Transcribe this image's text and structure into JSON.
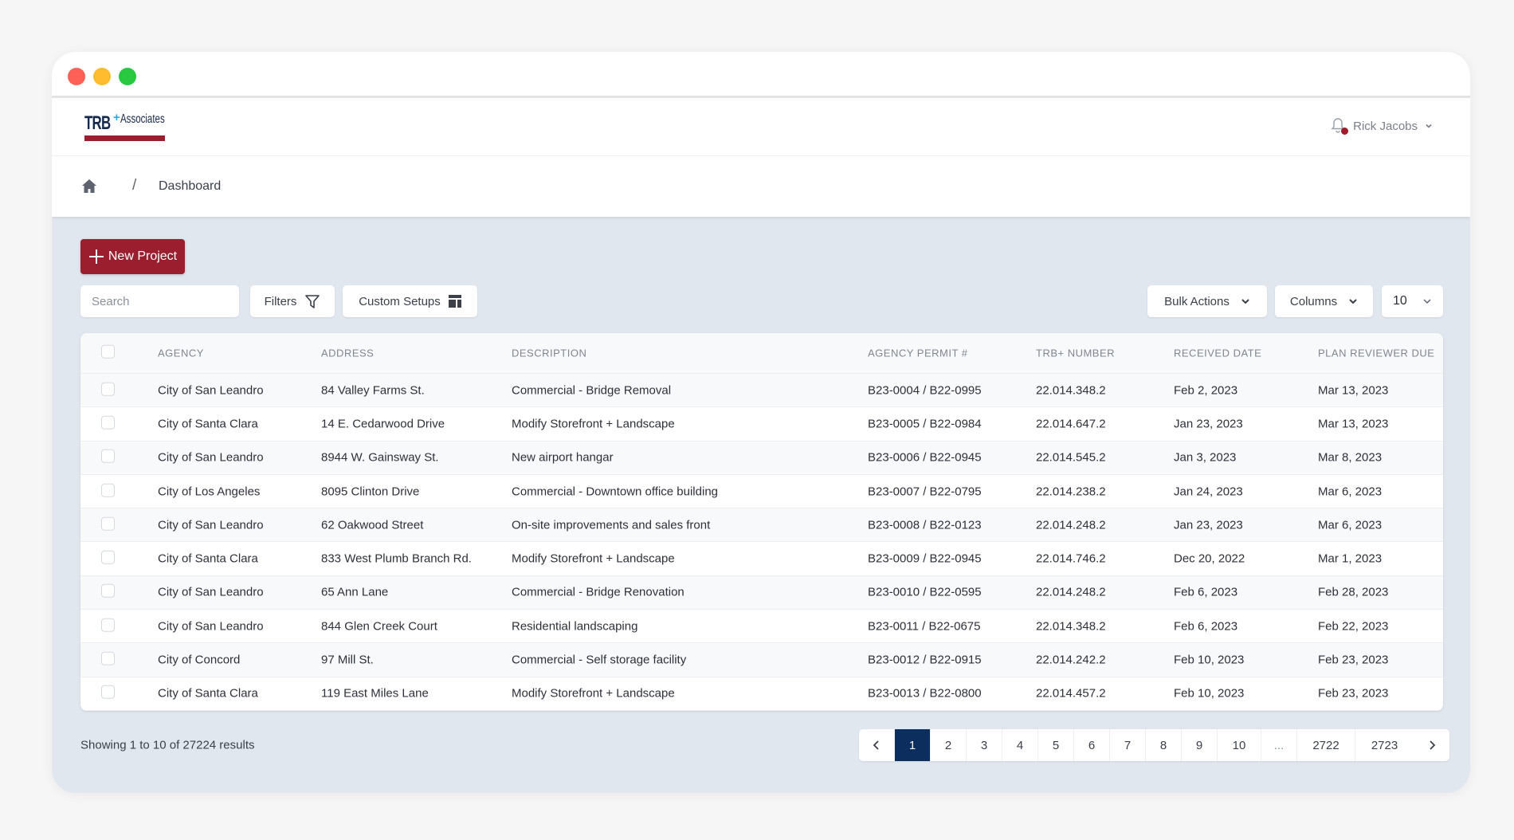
{
  "logo": {
    "text": "TRB",
    "plus": "+",
    "sub": "Associates"
  },
  "user": {
    "name": "Rick Jacobs"
  },
  "breadcrumb": {
    "separator": "/",
    "current": "Dashboard"
  },
  "toolbar": {
    "new_project": "New Project",
    "search_placeholder": "Search",
    "filters": "Filters",
    "custom_setups": "Custom Setups",
    "bulk_actions": "Bulk Actions",
    "columns": "Columns",
    "page_size": "10"
  },
  "table": {
    "headers": [
      "Agency",
      "Address",
      "Description",
      "Agency Permit #",
      "TRB+ Number",
      "Received Date",
      "Plan Reviewer Due"
    ],
    "rows": [
      [
        "City of San Leandro",
        "84 Valley Farms St.",
        "Commercial - Bridge Removal",
        "B23-0004 / B22-0995",
        "22.014.348.2",
        "Feb 2, 2023",
        "Mar 13, 2023"
      ],
      [
        "City of Santa Clara",
        "14 E. Cedarwood Drive",
        "Modify Storefront + Landscape",
        "B23-0005 / B22-0984",
        "22.014.647.2",
        "Jan 23, 2023",
        "Mar 13, 2023"
      ],
      [
        "City of San Leandro",
        "8944 W. Gainsway St.",
        "New airport hangar",
        "B23-0006 / B22-0945",
        "22.014.545.2",
        "Jan 3, 2023",
        "Mar 8, 2023"
      ],
      [
        "City of Los Angeles",
        "8095 Clinton Drive",
        "Commercial - Downtown office building",
        "B23-0007 / B22-0795",
        "22.014.238.2",
        "Jan 24, 2023",
        "Mar 6, 2023"
      ],
      [
        "City of San Leandro",
        "62 Oakwood Street",
        "On-site improvements and sales front",
        "B23-0008 / B22-0123",
        "22.014.248.2",
        "Jan 23, 2023",
        "Mar 6, 2023"
      ],
      [
        "City of Santa Clara",
        "833 West Plumb Branch Rd.",
        "Modify Storefront + Landscape",
        "B23-0009 / B22-0945",
        "22.014.746.2",
        "Dec 20, 2022",
        "Mar 1, 2023"
      ],
      [
        "City of San Leandro",
        "65 Ann Lane",
        "Commercial - Bridge Renovation",
        "B23-0010 / B22-0595",
        "22.014.248.2",
        "Feb 6, 2023",
        "Feb 28, 2023"
      ],
      [
        "City of San Leandro",
        "844 Glen Creek Court",
        "Residential landscaping",
        "B23-0011 / B22-0675",
        "22.014.348.2",
        "Feb 6, 2023",
        "Feb 22, 2023"
      ],
      [
        "City of Concord",
        "97 Mill St.",
        "Commercial - Self storage facility",
        "B23-0012 / B22-0915",
        "22.014.242.2",
        "Feb 10, 2023",
        "Feb 23, 2023"
      ],
      [
        "City of Santa Clara",
        "119 East Miles Lane",
        "Modify Storefront + Landscape",
        "B23-0013 / B22-0800",
        "22.014.457.2",
        "Feb 10, 2023",
        "Feb 23, 2023"
      ]
    ]
  },
  "footer": {
    "showing": "Showing 1 to 10 of 27224 results"
  },
  "pagination": {
    "pages": [
      "1",
      "2",
      "3",
      "4",
      "5",
      "6",
      "7",
      "8",
      "9",
      "10",
      "...",
      "2722",
      "2723"
    ],
    "current": "1"
  },
  "colors": {
    "brand_red": "#9b1e2e",
    "navy": "#0c2e5e",
    "accent_blue": "#2aa8e0"
  }
}
